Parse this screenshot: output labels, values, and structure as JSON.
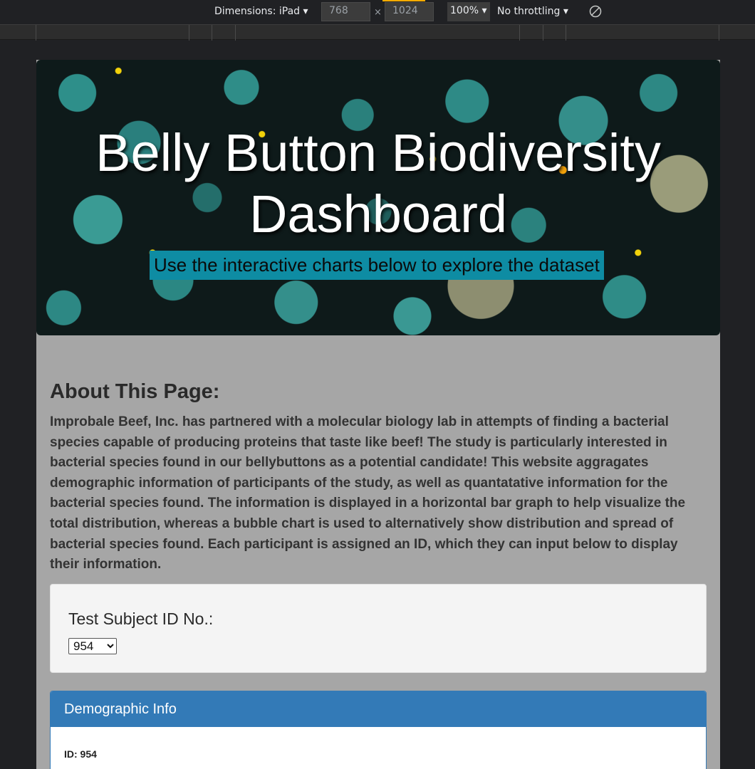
{
  "devtools": {
    "device_label": "Dimensions: iPad",
    "width_value": "768",
    "height_value": "1024",
    "zoom": "100%",
    "throttling": "No throttling"
  },
  "header": {
    "title": "Belly Button Biodiversity Dashboard",
    "subtitle": "Use the interactive charts below to explore the dataset"
  },
  "about": {
    "title": "About This Page:",
    "text": "Improbale Beef, Inc. has partnered with a molecular biology lab in attempts of finding a bacterial species capable of producing proteins that taste like beef! The study is particularly interested in bacterial species found in our bellybuttons as a potential candidate! This website aggragates demographic information of participants of the study, as well as quantatative information for the bacterial species found. The information is displayed in a horizontal bar graph to help visualize the total distribution, whereas a bubble chart is used to alternatively show distribution and spread of bacterial species found. Each participant is assigned an ID, which they can input below to display their information."
  },
  "selector": {
    "label": "Test Subject ID No.:",
    "selected": "954"
  },
  "demographic": {
    "heading": "Demographic Info",
    "id_line": "ID: 954"
  }
}
